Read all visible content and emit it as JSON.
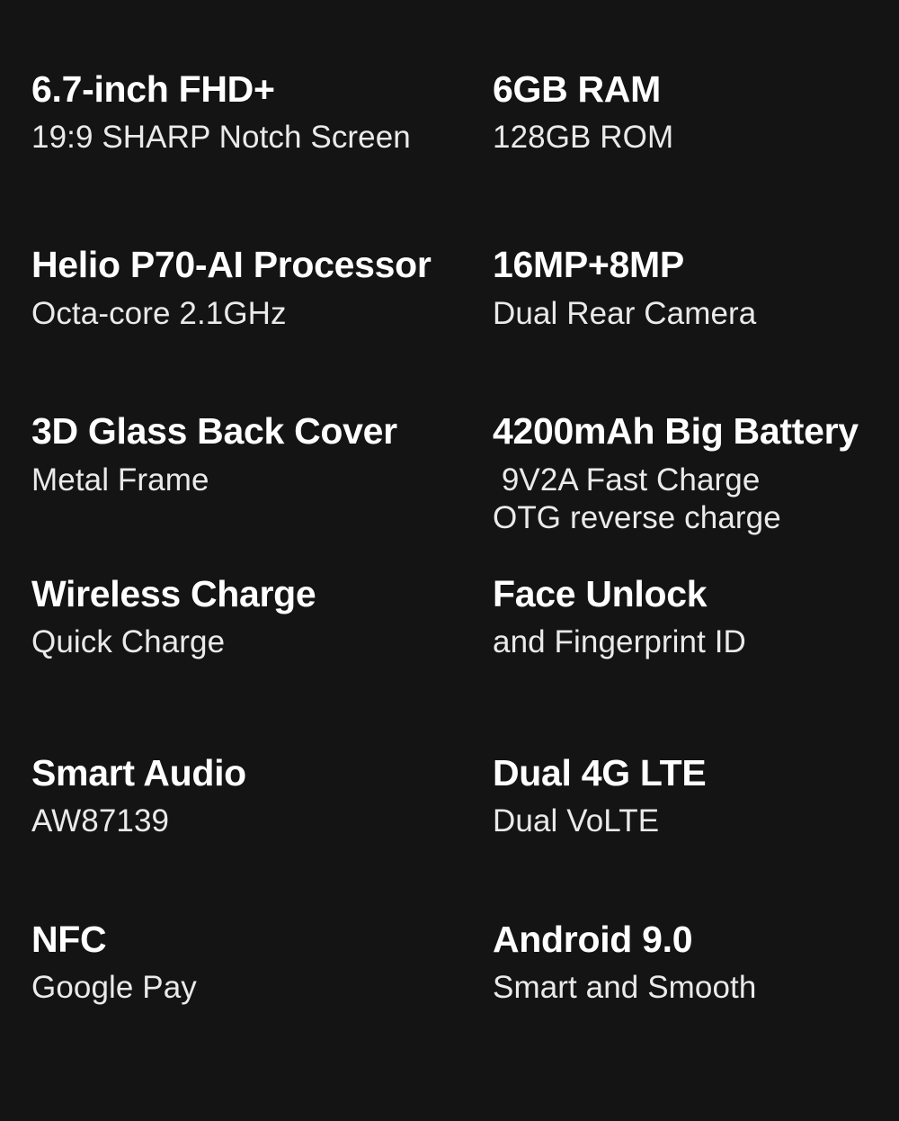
{
  "page": {
    "background_color": "#141414",
    "title_color": "#ffffff",
    "subtitle_color": "#eaeaea"
  },
  "specs": {
    "rows": [
      {
        "left": {
          "title": "6.7-inch FHD+",
          "sub": "19:9 SHARP Notch Screen"
        },
        "right": {
          "title": "6GB RAM",
          "sub": "128GB ROM"
        }
      },
      {
        "left": {
          "title": "Helio P70-AI Processor",
          "sub": "Octa-core 2.1GHz"
        },
        "right": {
          "title": "16MP+8MP",
          "sub": "Dual Rear Camera"
        }
      },
      {
        "left": {
          "title": "3D Glass Back Cover",
          "sub": "Metal Frame"
        },
        "right": {
          "title": "4200mAh Big Battery",
          "sub": " 9V2A Fast Charge",
          "sub2": "OTG reverse charge"
        }
      },
      {
        "left": {
          "title": "Wireless Charge",
          "sub": "Quick Charge"
        },
        "right": {
          "title": "Face Unlock",
          "sub": "and Fingerprint ID"
        }
      },
      {
        "left": {
          "title": "Smart Audio",
          "sub": "AW87139"
        },
        "right": {
          "title": "Dual 4G LTE",
          "sub": "Dual VoLTE"
        }
      },
      {
        "left": {
          "title": "NFC",
          "sub": "Google Pay"
        },
        "right": {
          "title": "Android 9.0",
          "sub": "Smart and Smooth"
        }
      }
    ]
  }
}
